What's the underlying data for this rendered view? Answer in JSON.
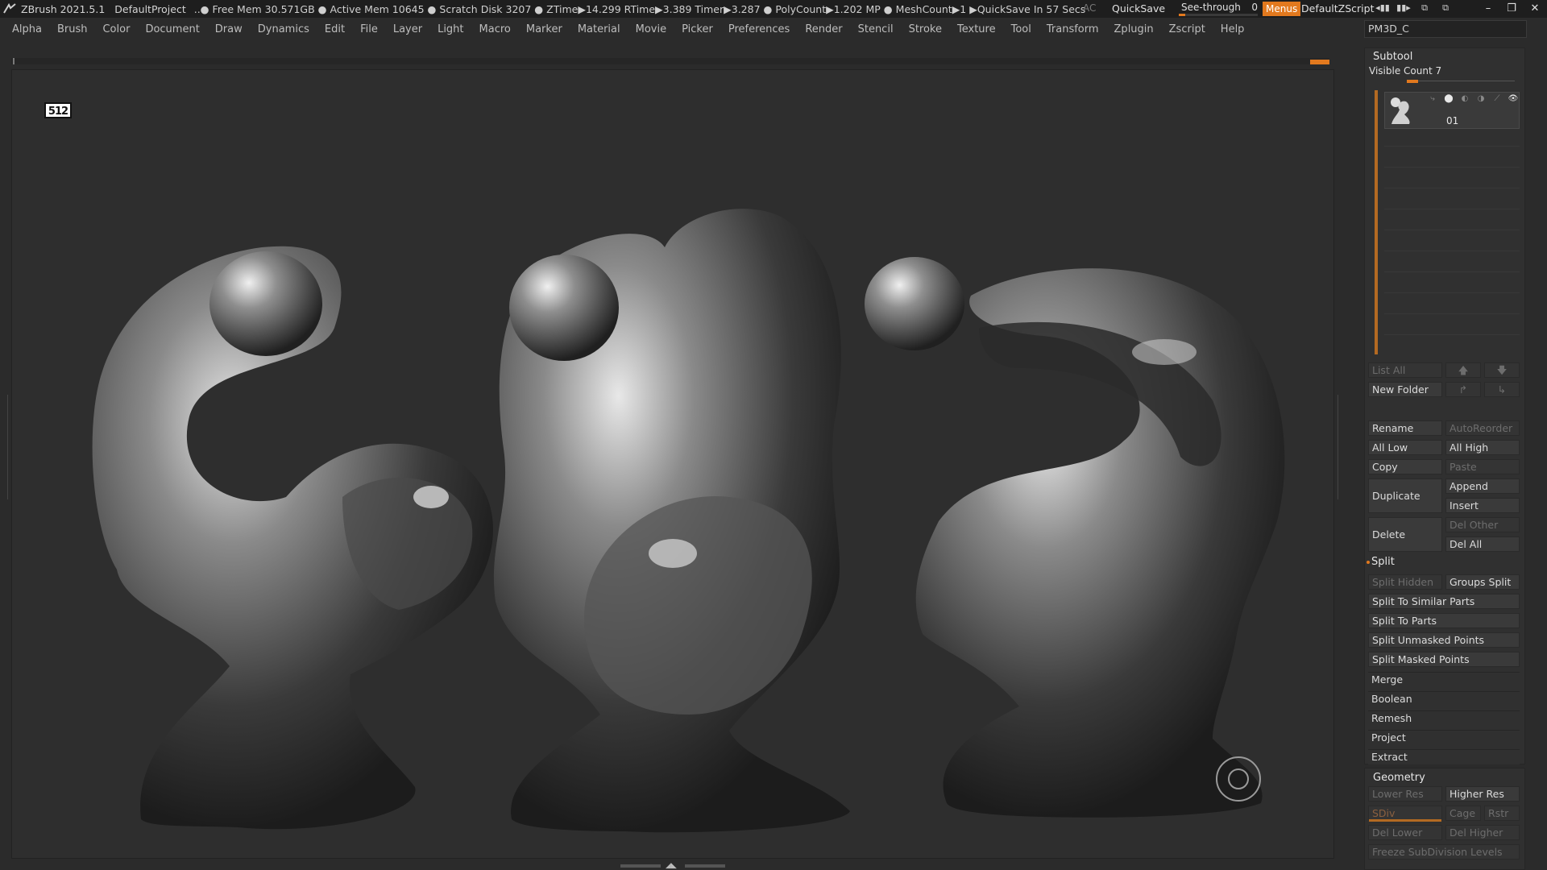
{
  "titlebar": {
    "app": "ZBrush 2021.5.1",
    "project": "DefaultProject",
    "stats": "..● Free Mem 30.571GB ● Active Mem 10645 ● Scratch Disk 3207 ●  ZTime▶14.299 RTime▶3.389 Timer▶3.287 ● PolyCount▶1.202 MP  ● MeshCount▶1  ▶QuickSave In 57 Secs",
    "ac": "AC",
    "quicksave": "QuickSave",
    "see_through_label": "See-through",
    "see_through_value": "0",
    "see_through_level": 0.08,
    "menus": "Menus",
    "default_zscript": "DefaultZScript"
  },
  "menubar": [
    "Alpha",
    "Brush",
    "Color",
    "Document",
    "Draw",
    "Dynamics",
    "Edit",
    "File",
    "Layer",
    "Light",
    "Macro",
    "Marker",
    "Material",
    "Movie",
    "Picker",
    "Preferences",
    "Render",
    "Stencil",
    "Stroke",
    "Texture",
    "Tool",
    "Transform",
    "Zplugin",
    "Zscript",
    "Help"
  ],
  "tool_name": "PM3D_C",
  "viewport": {
    "badge": "512"
  },
  "subtool": {
    "title": "Subtool",
    "visible_count": "Visible Count 7",
    "item_name": "01",
    "list_all": "List All",
    "new_folder": "New Folder",
    "rename": "Rename",
    "autoreorder": "AutoReorder",
    "all_low": "All Low",
    "all_high": "All High",
    "copy": "Copy",
    "paste": "Paste",
    "duplicate": "Duplicate",
    "append": "Append",
    "insert": "Insert",
    "delete": "Delete",
    "del_other": "Del Other",
    "del_all": "Del All",
    "split": "Split",
    "split_hidden": "Split Hidden",
    "groups_split": "Groups Split",
    "split_to_similar": "Split To Similar Parts",
    "split_to_parts": "Split To Parts",
    "split_unmasked": "Split Unmasked Points",
    "split_masked": "Split Masked Points",
    "merge": "Merge",
    "boolean": "Boolean",
    "remesh": "Remesh",
    "project": "Project",
    "extract": "Extract"
  },
  "geometry": {
    "title": "Geometry",
    "lower_res": "Lower Res",
    "higher_res": "Higher Res",
    "sdiv": "SDiv",
    "cage": "Cage",
    "rstr": "Rstr",
    "del_lower": "Del Lower",
    "del_higher": "Del Higher",
    "freeze": "Freeze SubDivision Levels"
  },
  "colors": {
    "accent": "#e2791e",
    "bg": "#2b2b2b",
    "viewport": "#2e2e2e"
  }
}
